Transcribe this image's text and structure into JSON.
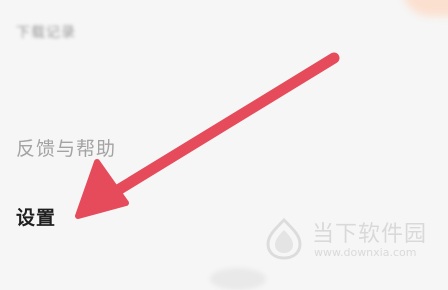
{
  "menu": {
    "items": [
      {
        "label": "下载记录"
      },
      {
        "label": "反馈与帮助"
      },
      {
        "label": "设置"
      }
    ]
  },
  "watermark": {
    "name": "当下软件园",
    "url": "www.downxia.com"
  },
  "colors": {
    "arrow": "#e54b5b",
    "background": "#f6f6f6",
    "settings_text": "#1f1f1f",
    "feedback_text": "#a3a3a3"
  }
}
